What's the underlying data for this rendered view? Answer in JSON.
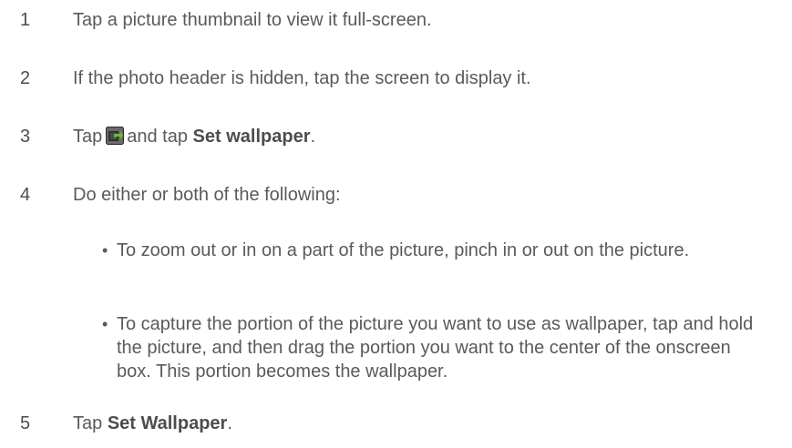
{
  "steps": [
    {
      "number": "1",
      "text": "Tap a picture thumbnail to view it full-screen."
    },
    {
      "number": "2",
      "text": "If the photo header is hidden, tap the screen to display it."
    },
    {
      "number": "3",
      "prefix": "Tap",
      "icon": "share-icon",
      "middle": "and tap",
      "bold": "Set wallpaper",
      "suffix": "."
    },
    {
      "number": "4",
      "text": "Do either or both of the following:"
    },
    {
      "number": "5",
      "prefix": "Tap",
      "bold": "Set Wallpaper",
      "suffix": "."
    }
  ],
  "bullets": [
    {
      "symbol": "•",
      "text": "To zoom out or in on a part of the picture, pinch in or out on the picture."
    },
    {
      "symbol": "•",
      "text": "To capture the portion of the picture you want to use as wallpaper, tap and hold the picture, and then drag the portion you want to the center of the onscreen box. This portion becomes the wallpaper."
    }
  ],
  "colors": {
    "text": "#5a5a5a",
    "icon_dark": "#2b2b2b",
    "icon_green": "#6fb83a"
  }
}
